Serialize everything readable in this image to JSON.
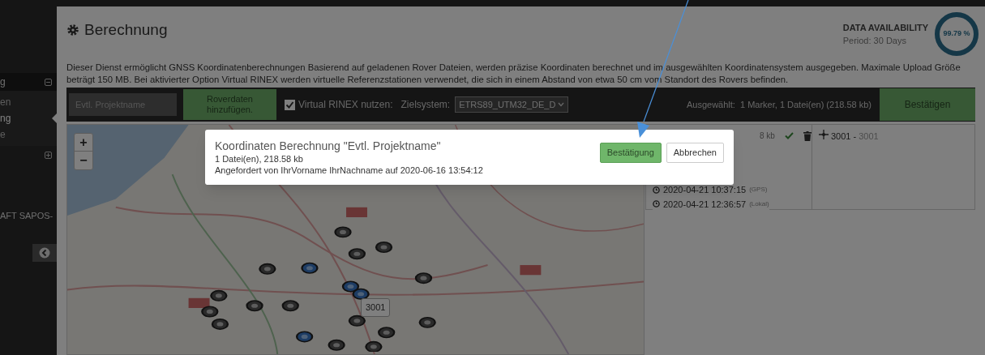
{
  "sidebar": {
    "items": [
      {
        "label": "g",
        "expanded": true,
        "children": [
          {
            "label": "en",
            "selected": false
          },
          {
            "label": "ng",
            "selected": true
          },
          {
            "label": "e",
            "selected": false
          }
        ]
      },
      {
        "expanded": false
      }
    ],
    "footer_text": "AFT SAPOS-"
  },
  "header": {
    "title": "Berechnung",
    "availability": {
      "title": "DATA AVAILABILITY",
      "period": "Period: 30 Days",
      "value": "99.79 %",
      "level": 0.9979
    }
  },
  "description": "Dieser Dienst ermöglicht GNSS Koordinatenberechnungen Basierend auf geladenen Rover Dateien, werden präzise Koordinaten berechnet und im ausgewählten Koordinatensystem ausgegeben. Maximale Upload Größe beträgt 150 MB. Bei aktivierter Option Virtual RINEX werden virtuelle Referenzstationen verwendet, die sich in einem Abstand von etwa 50 cm vom Standort des Rovers befinden.",
  "toolbar": {
    "project_field": {
      "placeholder": "Evtl. Projektname"
    },
    "add_button": "Roverdaten hinzufügen.",
    "virtual_rinex": {
      "label": "Virtual RINEX nutzen:",
      "checked": true
    },
    "target_label": "Zielsystem:",
    "target_value": "ETRS89_UTM32_DE_D",
    "selection": "Ausgewählt:  1 Marker, 1 Datei(en) (218.58 kb)",
    "confirm_button": "Bestätigen"
  },
  "map": {
    "zoom_in": "+",
    "zoom_out": "−",
    "tooltip": "3001"
  },
  "file_panel": {
    "size": "8 kb",
    "uploaded": true,
    "times": [
      {
        "value": "2020-04-21 10:37:15",
        "note": "(GPS)"
      },
      {
        "value": "2020-04-21 12:36:57",
        "note": "(Lokal)"
      }
    ],
    "marker": {
      "label": "3001 -",
      "name": "3001"
    }
  },
  "dialog": {
    "title": "Koordinaten Berechnung \"Evtl. Projektname\"",
    "files": "1 Datei(en), 218.58 kb",
    "requested": "Angefordert von IhrVorname IhrNachname auf 2020-06-16 13:54:12",
    "confirm": "Bestätigung",
    "cancel": "Abbrechen"
  }
}
